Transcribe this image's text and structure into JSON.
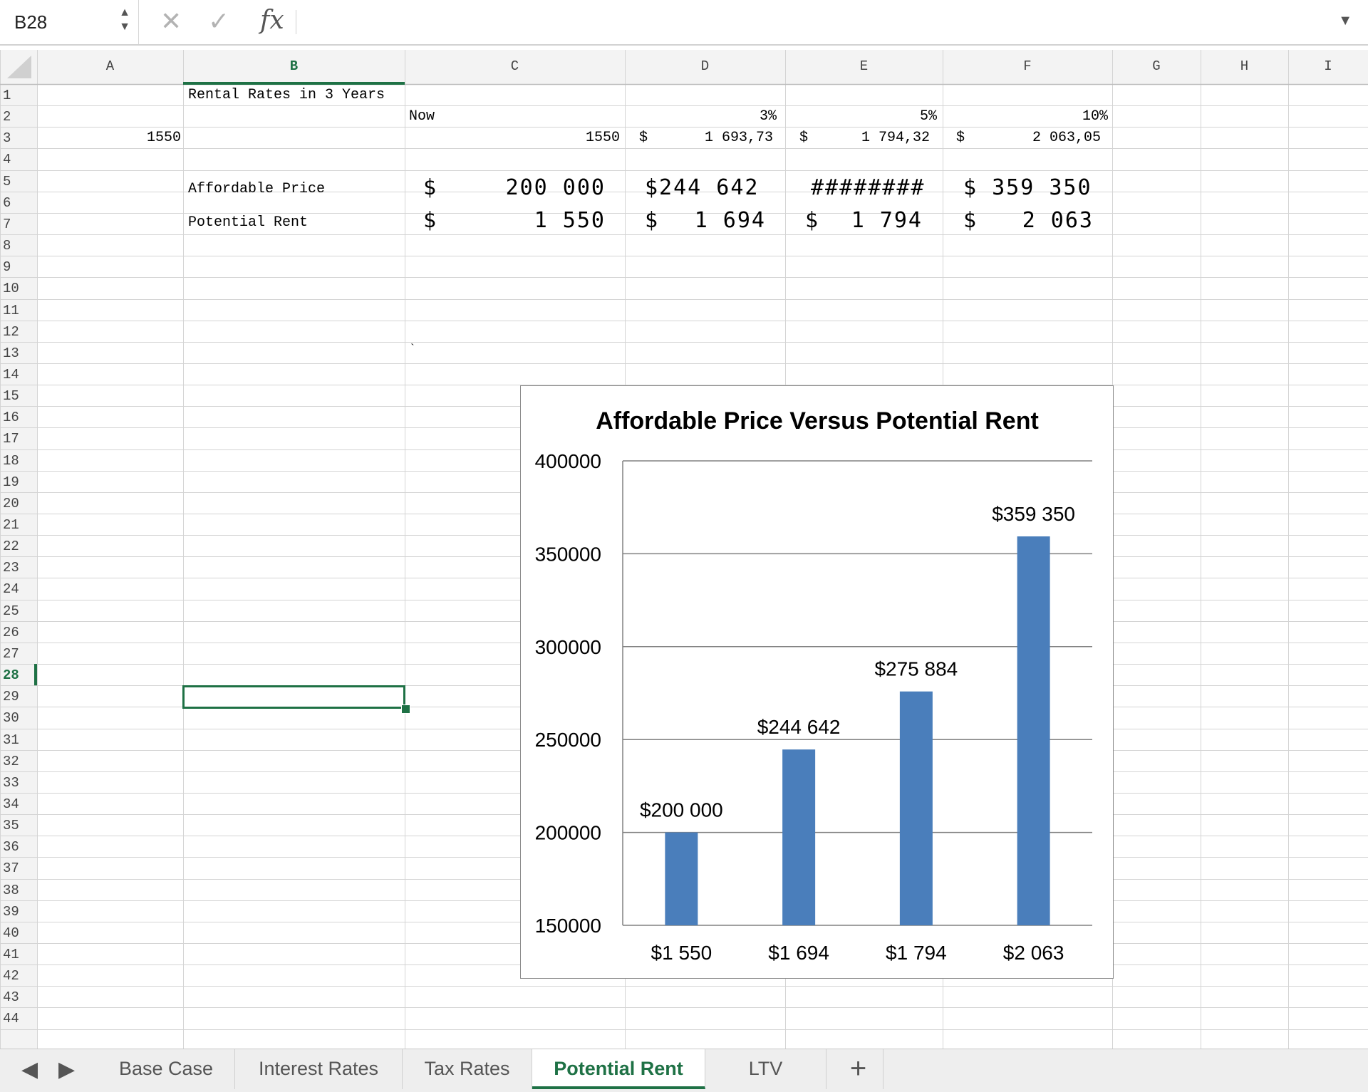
{
  "formula_bar": {
    "name_box": "B28",
    "cancel_glyph": "✕",
    "enter_glyph": "✓",
    "fx_label": "fx",
    "formula_value": ""
  },
  "columns": [
    "A",
    "B",
    "C",
    "D",
    "E",
    "F",
    "G",
    "H",
    "I"
  ],
  "active_column": "B",
  "active_row": 28,
  "row_count": 44,
  "cells": {
    "B1": "Rental Rates in 3 Years",
    "C2": "Now",
    "D2": "3%",
    "E2": "5%",
    "F2": "10%",
    "A3": "1550",
    "C3": "1550",
    "D3_sym": "$",
    "D3": "1 693,73",
    "E3_sym": "$",
    "E3": "1 794,32",
    "F3_sym": "$",
    "F3": "2 063,05",
    "B5": "Affordable Price",
    "C5_sym": "$",
    "C5": "200 000",
    "D5": "$244 642",
    "E5": "########",
    "F5": "$ 359 350",
    "B6": "Potential Rent",
    "C6_sym": "$",
    "C6": "1 550",
    "D6_sym": "$",
    "D6": "1 694",
    "E6_sym": "$",
    "E6": "1 794",
    "F6_sym": "$",
    "F6": "2 063",
    "C12": "`"
  },
  "chart_data": {
    "type": "bar",
    "title": "Affordable Price Versus Potential Rent",
    "categories": [
      "$1 550",
      "$1 694",
      "$1 794",
      "$2 063"
    ],
    "values": [
      200000,
      244642,
      275884,
      359350
    ],
    "data_labels": [
      "$200 000",
      "$244 642",
      "$275 884",
      "$359 350"
    ],
    "ylim": [
      150000,
      400000
    ],
    "yticks": [
      "150000",
      "200000",
      "250000",
      "300000",
      "350000",
      "400000"
    ],
    "ytick_values": [
      150000,
      200000,
      250000,
      300000,
      350000,
      400000
    ],
    "xlabel": "",
    "ylabel": "",
    "grid": true,
    "legend": "none",
    "bar_color": "#4a7ebb"
  },
  "sheet_tabs": [
    {
      "label": "Base Case",
      "active": false
    },
    {
      "label": "Interest Rates",
      "active": false
    },
    {
      "label": "Tax Rates",
      "active": false
    },
    {
      "label": "Potential Rent",
      "active": true
    },
    {
      "label": "LTV",
      "active": false
    }
  ],
  "add_sheet_label": "+",
  "nav_prev": "◀",
  "nav_next": "▶",
  "accent_color": "#1e7145"
}
